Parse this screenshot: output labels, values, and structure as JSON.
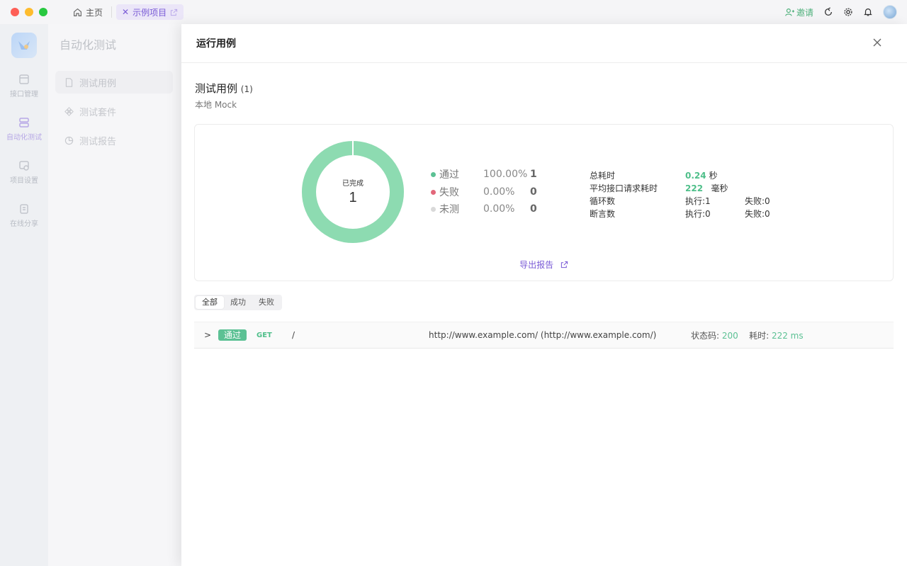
{
  "titlebar": {
    "home_tab": "主页",
    "project_tab": "示例项目",
    "invite": "邀请"
  },
  "app_nav": [
    {
      "label": "接口管理",
      "icon": "api-icon"
    },
    {
      "label": "自动化测试",
      "icon": "automation-icon"
    },
    {
      "label": "项目设置",
      "icon": "settings-icon"
    },
    {
      "label": "在线分享",
      "icon": "share-icon"
    }
  ],
  "sub_sidebar": {
    "title": "自动化测试",
    "items": [
      {
        "label": "测试用例",
        "icon": "file-icon"
      },
      {
        "label": "测试套件",
        "icon": "suite-icon"
      },
      {
        "label": "测试报告",
        "icon": "report-icon"
      }
    ]
  },
  "drawer": {
    "title": "运行用例",
    "case_title": "测试用例",
    "case_count": "(1)",
    "environment": "本地 Mock",
    "donut_caption": "已完成",
    "donut_total": "1",
    "donut_pass_fraction": 1.0,
    "legend": [
      {
        "label": "通过",
        "percent": "100.00%",
        "count": "1",
        "color": "#5cc194"
      },
      {
        "label": "失败",
        "percent": "0.00%",
        "count": "0",
        "color": "#e2677a"
      },
      {
        "label": "未测",
        "percent": "0.00%",
        "count": "0",
        "color": "#d9d9d9"
      }
    ],
    "stats": {
      "total_time_label": "总耗时",
      "total_time_value": "0.24",
      "total_time_unit": "秒",
      "avg_time_label": "平均接口请求耗时",
      "avg_time_value": "222",
      "avg_time_unit": "毫秒",
      "loops_label": "循环数",
      "loops_exec": "执行:1",
      "loops_fail": "失败:0",
      "assert_label": "断言数",
      "assert_exec": "执行:0",
      "assert_fail": "失败:0"
    },
    "export_label": "导出报告",
    "filters": [
      "全部",
      "成功",
      "失败"
    ],
    "result": {
      "badge": "通过",
      "method": "GET",
      "path": "/",
      "url": "http://www.example.com/ (http://www.example.com/)",
      "status_label": "状态码:",
      "status_value": "200",
      "time_label": "耗时:",
      "time_value": "222 ms"
    }
  },
  "colors": {
    "accent": "#7a5bd6",
    "success": "#5cc194",
    "danger": "#e2677a"
  }
}
